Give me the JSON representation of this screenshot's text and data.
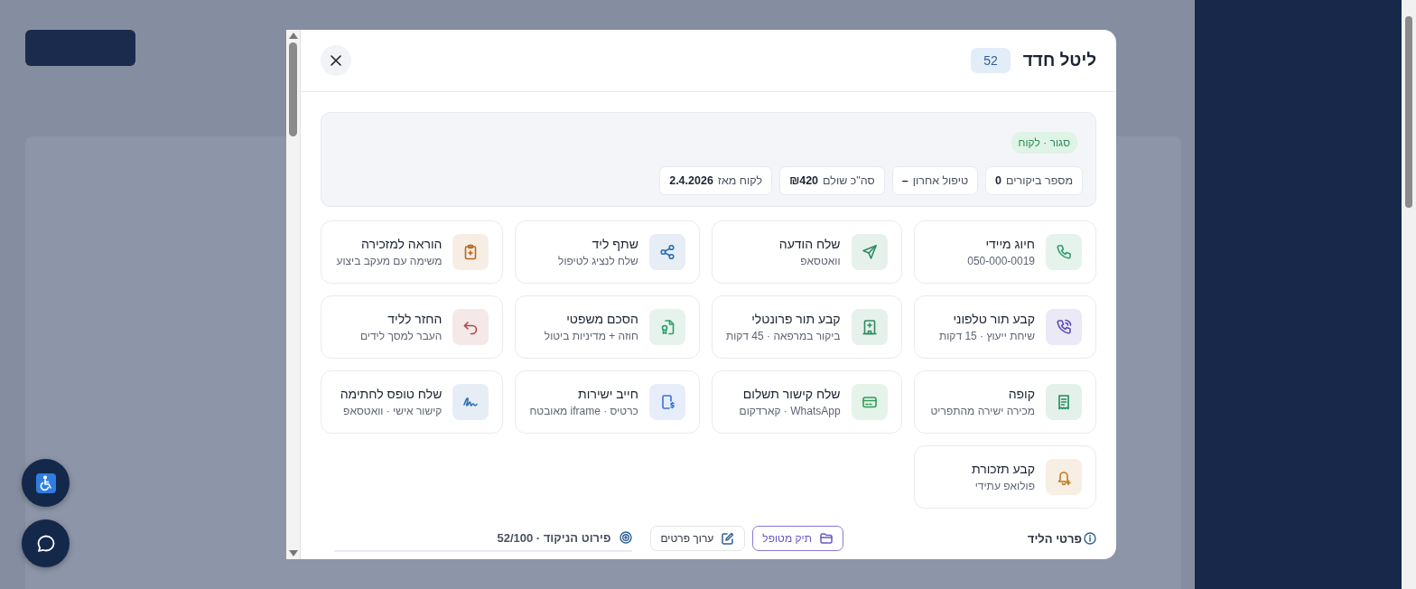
{
  "dialog": {
    "title": "ליטל חדד",
    "score_badge": "52"
  },
  "summary": {
    "status_tag": "סגור · לקוח",
    "stats": [
      {
        "label": "מספר ביקורים",
        "value": "0"
      },
      {
        "label": "טיפול אחרון",
        "value": "–"
      },
      {
        "label": "סה\"כ שולם",
        "value": "₪420"
      },
      {
        "label": "לקוח מאז",
        "value": "2.4.2026"
      }
    ]
  },
  "actions": [
    {
      "title": "חיוג מיידי",
      "subtitle": "050-000-0019",
      "color": "#2e9e6b"
    },
    {
      "title": "שלח הודעה",
      "subtitle": "וואטסאפ",
      "color": "#2e8b62"
    },
    {
      "title": "שתף ליד",
      "subtitle": "שלח לנציג לטיפול",
      "color": "#2f6fb0"
    },
    {
      "title": "הוראה למזכירה",
      "subtitle": "משימה עם מעקב ביצוע",
      "color": "#b7681f"
    },
    {
      "title": "קבע תור טלפוני",
      "subtitle": "שיחת ייעוץ · 15 דקות",
      "color": "#5b4bb5"
    },
    {
      "title": "קבע תור פרונטלי",
      "subtitle": "ביקור במרפאה · 45 דקות",
      "color": "#2e8b62"
    },
    {
      "title": "הסכם משפטי",
      "subtitle": "חוזה + מדיניות ביטול",
      "color": "#2e9e6b"
    },
    {
      "title": "החזר לליד",
      "subtitle": "העבר למסך לידים",
      "color": "#b04545"
    },
    {
      "title": "קופה",
      "subtitle": "מכירה ישירה מהתפריט",
      "color": "#1f8a5a"
    },
    {
      "title": "שלח קישור תשלום",
      "subtitle": "WhatsApp · קארדקום",
      "color": "#2e9e55"
    },
    {
      "title": "חייב ישירות",
      "subtitle": "כרטיס · iframe מאובטח",
      "color": "#3b6fd6"
    },
    {
      "title": "שלח טופס לחתימה",
      "subtitle": "קישור אישי · וואטסאפ",
      "color": "#2f6fb0"
    },
    {
      "title": "קבע תזכורת",
      "subtitle": "פולואפ עתידי",
      "color": "#c07a20"
    }
  ],
  "footer": {
    "section_title": "פרטי הליד",
    "buttons": [
      {
        "label": "תיק מטופל",
        "kind": "primary"
      },
      {
        "label": "ערוך פרטים",
        "kind": "secondary"
      }
    ],
    "score_breakdown": "פירוט הניקוד · 52/100"
  }
}
